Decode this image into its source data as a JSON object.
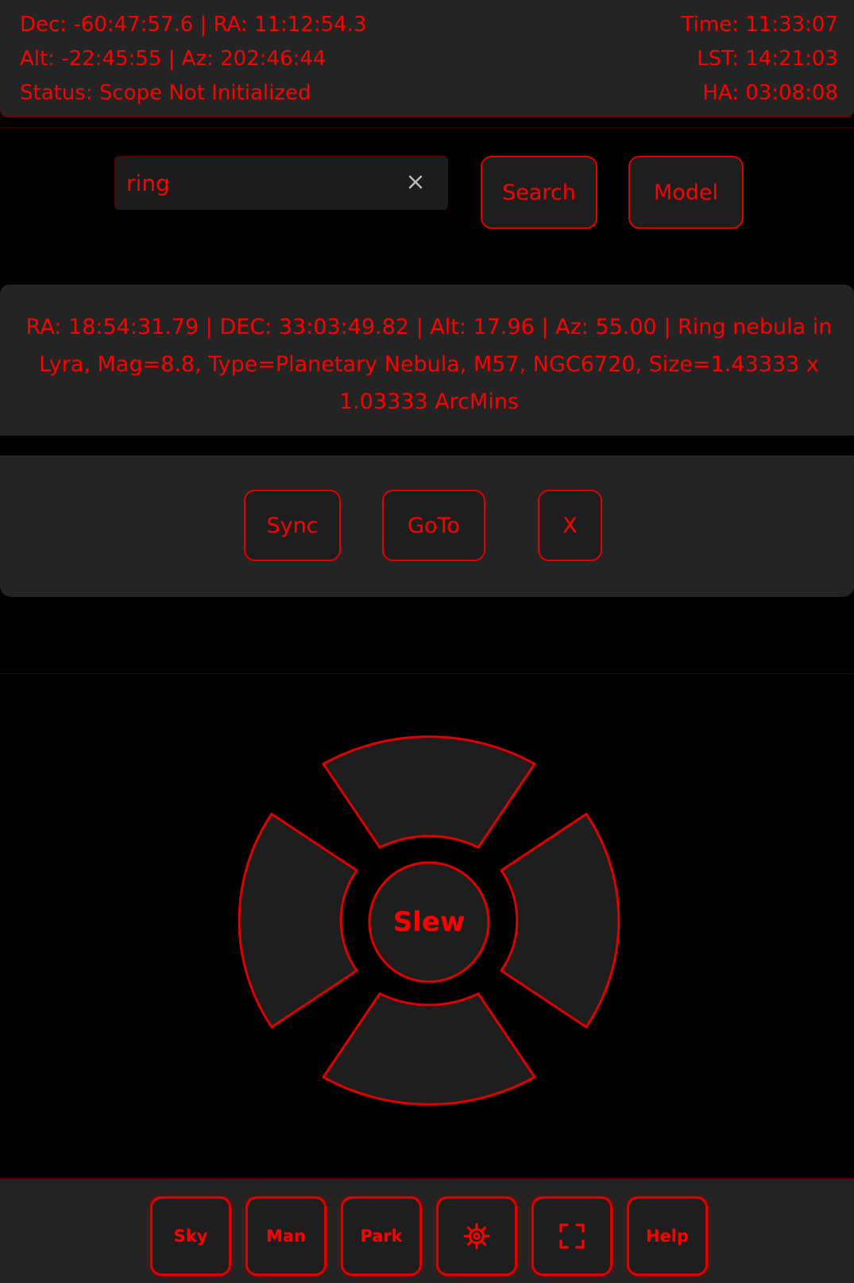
{
  "header": {
    "dec_ra": "Dec: -60:47:57.6 | RA: 11:12:54.3",
    "alt_az": "Alt: -22:45:55 | Az: 202:46:44",
    "status": "Status: Scope Not Initialized",
    "time": "Time: 11:33:07",
    "lst": "LST: 14:21:03",
    "ha": "HA: 03:08:08"
  },
  "search": {
    "value": "ring",
    "clear_icon": "close-icon",
    "search_label": "Search",
    "model_label": "Model"
  },
  "object_info": {
    "text": "RA: 18:54:31.79 | DEC: 33:03:49.82 | Alt: 17.96 | Az: 55.00 | Ring nebula in Lyra, Mag=8.8, Type=Planetary Nebula, M57, NGC6720, Size=1.43333 x 1.03333 ArcMins"
  },
  "actions": {
    "sync_label": "Sync",
    "goto_label": "GoTo",
    "x_label": "X"
  },
  "slew": {
    "label": "Slew"
  },
  "nav": {
    "sky": "Sky",
    "man": "Man",
    "park": "Park",
    "settings_icon": "gear-icon",
    "fullscreen_icon": "fullscreen-icon",
    "help": "Help"
  },
  "theme": {
    "accent": "#ff0000",
    "panel": "#242424",
    "background": "#000000"
  }
}
